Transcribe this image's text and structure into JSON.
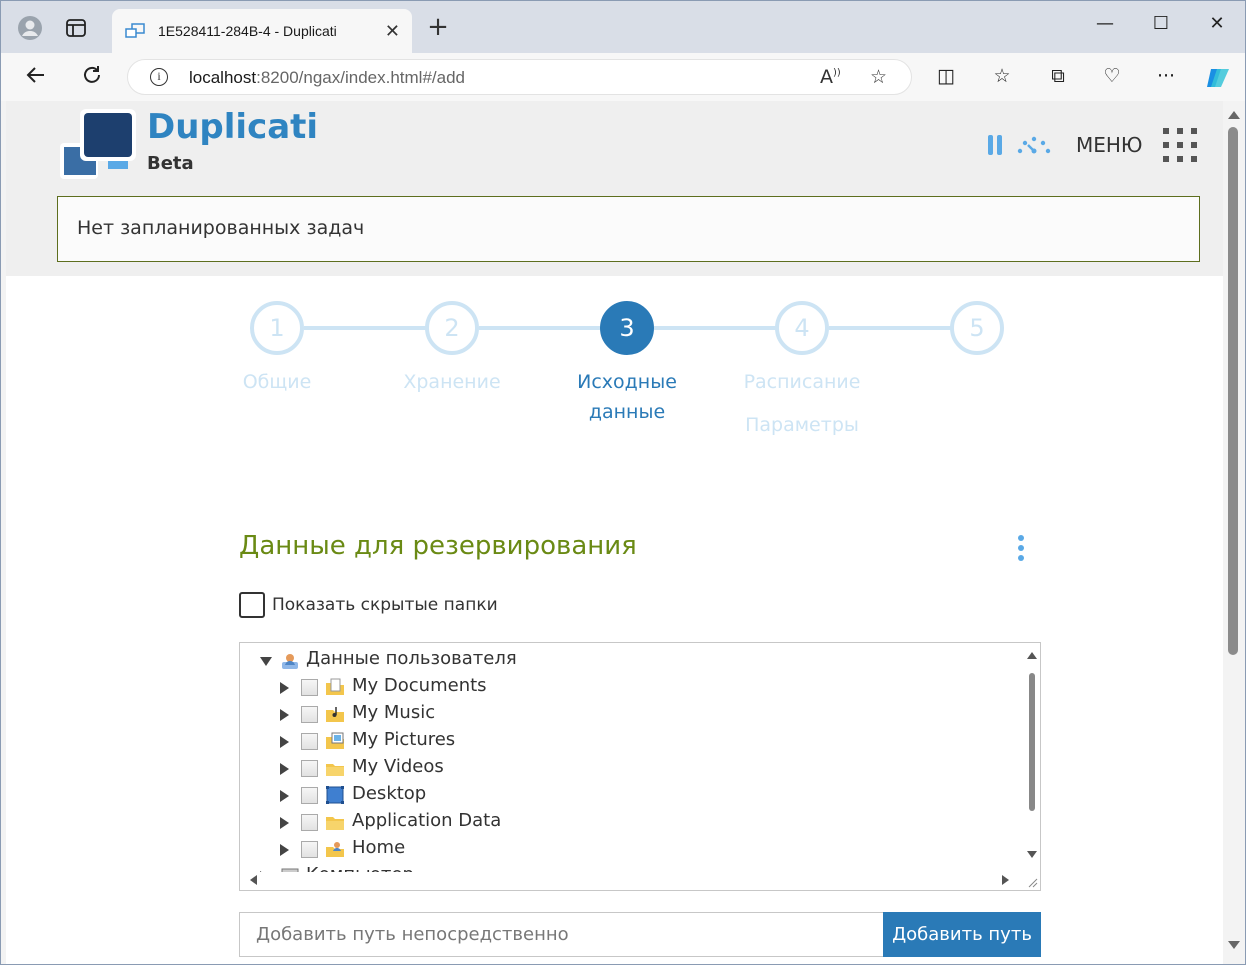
{
  "browser": {
    "tab_title": "1E528411-284B-4 - Duplicati",
    "new_tab_icon": "plus-icon",
    "url_host": "localhost",
    "url_rest": ":8200/ngax/index.html#/add",
    "window_controls": [
      "minimize",
      "maximize",
      "close"
    ]
  },
  "app": {
    "brand": "Duplicati",
    "brand_sub": "Beta",
    "menu_label": "МЕНЮ",
    "notice": "Нет запланированных задач",
    "accent_color": "#2a7ab7",
    "title_color": "#6a8a14"
  },
  "steps": [
    {
      "num": "1",
      "label": "Общие",
      "active": false
    },
    {
      "num": "2",
      "label": "Хранение",
      "active": false
    },
    {
      "num": "3",
      "label": "Исходные данные",
      "active": true
    },
    {
      "num": "4",
      "label": "Расписание",
      "active": false
    },
    {
      "num": "5",
      "label": "Параметры",
      "active": false
    }
  ],
  "source": {
    "title": "Данные для резервирования",
    "show_hidden_label": "Показать скрытые папки",
    "tree": [
      {
        "label": "Данные пользователя",
        "expanded": true,
        "icon": "user-folder-icon"
      },
      {
        "label": "My Documents",
        "icon": "documents-folder-icon"
      },
      {
        "label": "My Music",
        "icon": "music-folder-icon"
      },
      {
        "label": "My Pictures",
        "icon": "pictures-folder-icon"
      },
      {
        "label": "My Videos",
        "icon": "videos-folder-icon"
      },
      {
        "label": "Desktop",
        "icon": "desktop-icon"
      },
      {
        "label": "Application Data",
        "icon": "folder-icon"
      },
      {
        "label": "Home",
        "icon": "home-folder-icon"
      },
      {
        "label": "Компьютер",
        "icon": "computer-icon"
      }
    ],
    "path_placeholder": "Добавить путь непосредственно",
    "add_path_label": "Добавить путь"
  }
}
